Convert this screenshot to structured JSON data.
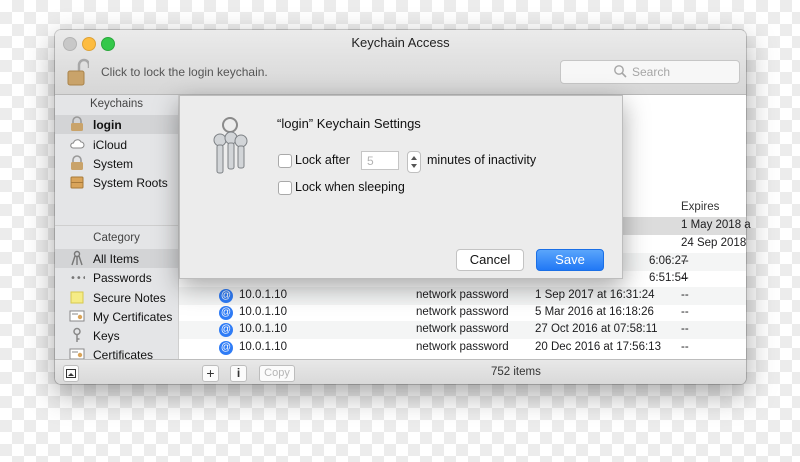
{
  "window": {
    "title": "Keychain Access",
    "lock_text": "Click to lock the login keychain.",
    "search_placeholder": "Search"
  },
  "sidebar": {
    "keychains_header": "Keychains",
    "keychains": [
      {
        "label": "login",
        "icon": "padlock-icon",
        "selected": true
      },
      {
        "label": "iCloud",
        "icon": "cloud-icon",
        "selected": false
      },
      {
        "label": "System",
        "icon": "padlock-icon",
        "selected": false
      },
      {
        "label": "System Roots",
        "icon": "cabinet-icon",
        "selected": false
      }
    ],
    "category_header": "Category",
    "categories": [
      {
        "label": "All Items",
        "icon": "all-items-icon",
        "selected": true
      },
      {
        "label": "Passwords",
        "icon": "key-dots-icon",
        "selected": false
      },
      {
        "label": "Secure Notes",
        "icon": "note-icon",
        "selected": false
      },
      {
        "label": "My Certificates",
        "icon": "certificate-icon",
        "selected": false
      },
      {
        "label": "Keys",
        "icon": "key-icon",
        "selected": false
      },
      {
        "label": "Certificates",
        "icon": "certificate-icon",
        "selected": false
      }
    ]
  },
  "table": {
    "expires_header": "Expires",
    "rows": [
      {
        "name": "",
        "kind": "",
        "date": "",
        "expires": "1 May 2018 a",
        "highlight": true
      },
      {
        "name": "",
        "kind": "",
        "date": "",
        "expires": "24 Sep 2018",
        "highlight": false
      },
      {
        "name": "",
        "kind": "",
        "date": "6:06:27",
        "expires": "--",
        "highlight": false
      },
      {
        "name": "",
        "kind": "",
        "date": "6:51:54",
        "expires": "--",
        "highlight": false
      },
      {
        "name": "10.0.1.10",
        "kind": "network password",
        "date": "1 Sep 2017 at 16:31:24",
        "expires": "--",
        "highlight": false
      },
      {
        "name": "10.0.1.10",
        "kind": "network password",
        "date": "5 Mar 2016 at 16:18:26",
        "expires": "--",
        "highlight": false
      },
      {
        "name": "10.0.1.10",
        "kind": "network password",
        "date": "27 Oct 2016 at 07:58:11",
        "expires": "--",
        "highlight": false
      },
      {
        "name": "10.0.1.10",
        "kind": "network password",
        "date": "20 Dec 2016 at 17:56:13",
        "expires": "--",
        "highlight": false
      }
    ]
  },
  "bottom": {
    "add_label": "+",
    "info_label": "i",
    "copy_label": "Copy",
    "count": "752 items"
  },
  "dialog": {
    "title": "“login” Keychain Settings",
    "lock_after_label": "Lock after",
    "lock_after_value": "5",
    "minutes_label": "minutes of inactivity",
    "lock_sleep_label": "Lock when sleeping",
    "cancel_label": "Cancel",
    "save_label": "Save"
  }
}
